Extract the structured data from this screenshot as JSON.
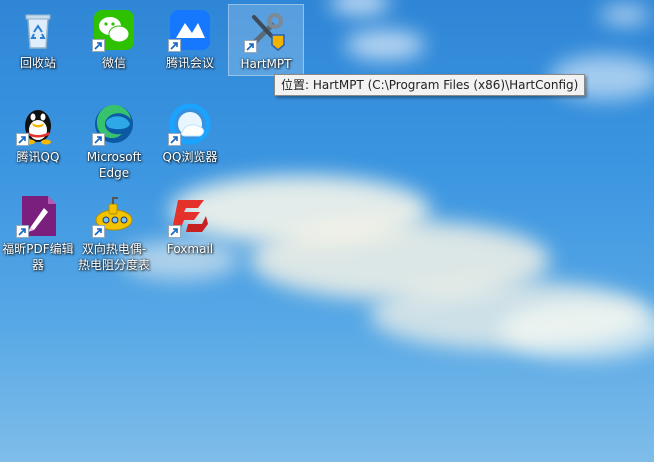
{
  "desktop": {
    "icons": [
      {
        "label": "回收站",
        "icon": "recycle-bin-icon"
      },
      {
        "label": "微信",
        "icon": "wechat-icon"
      },
      {
        "label": "腾讯会议",
        "icon": "tencent-meeting-icon"
      },
      {
        "label": "HartMPT",
        "icon": "tools-icon"
      },
      {
        "label": "腾讯QQ",
        "icon": "qq-penguin-icon"
      },
      {
        "label": "Microsoft\nEdge",
        "icon": "edge-icon"
      },
      {
        "label": "QQ浏览器",
        "icon": "qq-browser-icon"
      },
      {
        "label": "福昕PDF编辑\n器",
        "icon": "foxit-pdf-icon"
      },
      {
        "label": "双向热电偶-\n热电阻分度表",
        "icon": "submarine-icon"
      },
      {
        "label": "Foxmail",
        "icon": "foxmail-icon"
      }
    ]
  },
  "tooltip": {
    "text": "位置: HartMPT (C:\\Program Files (x86)\\HartConfig)"
  },
  "colors": {
    "sky_top": "#2f86d6",
    "sky_bottom": "#7fbde9",
    "selection": "#ffffff"
  }
}
